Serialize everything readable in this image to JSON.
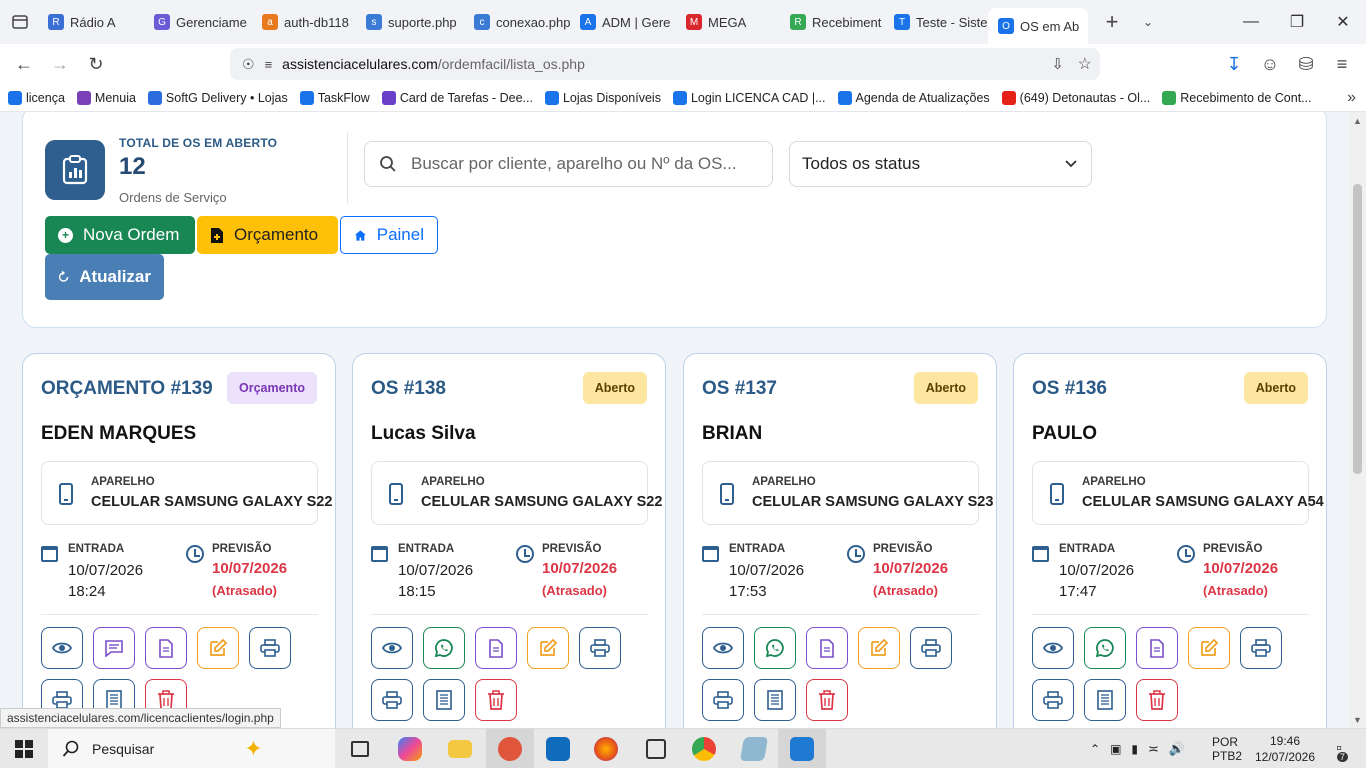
{
  "browser": {
    "tabs": [
      {
        "title": "Rádio A",
        "color": "#3b6fd6",
        "glyph": "R"
      },
      {
        "title": "Gerenciame",
        "color": "#6a5bd6",
        "glyph": "G"
      },
      {
        "title": "auth-db118",
        "color": "#e87a1d",
        "glyph": "a"
      },
      {
        "title": "suporte.php",
        "color": "#3a7bd5",
        "glyph": "s"
      },
      {
        "title": "conexao.php",
        "color": "#3a7bd5",
        "glyph": "c"
      },
      {
        "title": "ADM | Gere",
        "color": "#1a73e8",
        "glyph": "A"
      },
      {
        "title": "MEGA",
        "color": "#d9272e",
        "glyph": "M"
      },
      {
        "title": "Recebiment",
        "color": "#34a853",
        "glyph": "R"
      },
      {
        "title": "Teste - Siste",
        "color": "#1a73e8",
        "glyph": "T"
      },
      {
        "title": "OS em Ab",
        "color": "#1a73e8",
        "glyph": "O",
        "active": true
      }
    ],
    "new_tab": "+",
    "url_host": "assistenciacelulares.com",
    "url_path": "/ordemfacil/lista_os.php",
    "bookmarks": [
      {
        "label": "licença",
        "color": "#1a73e8"
      },
      {
        "label": "Menuia",
        "color": "#7b3fb8"
      },
      {
        "label": "SoftG Delivery • Lojas",
        "color": "#2d6cdf"
      },
      {
        "label": "TaskFlow",
        "color": "#1a73e8"
      },
      {
        "label": "Card de Tarefas - Dee...",
        "color": "#6a3fc9"
      },
      {
        "label": "Lojas Disponíveis",
        "color": "#1a73e8"
      },
      {
        "label": "Login LICENCA CAD  |...",
        "color": "#1a73e8"
      },
      {
        "label": "Agenda de Atualizações",
        "color": "#1a73e8"
      },
      {
        "label": "(649) Detonautas - Ol...",
        "color": "#e62117"
      },
      {
        "label": "Recebimento de Cont...",
        "color": "#34a853"
      }
    ],
    "status_url": "assistenciacelulares.com/licencaclientes/login.php"
  },
  "summary": {
    "label": "TOTAL DE OS EM ABERTO",
    "count": "12",
    "sub": "Ordens de Serviço",
    "search_placeholder": "Buscar por cliente, aparelho ou Nº da OS...",
    "status_select": "Todos os status"
  },
  "buttons": {
    "nova": "Nova Ordem",
    "orcamento": "Orçamento",
    "painel": "Painel",
    "atualizar": "Atualizar"
  },
  "labels": {
    "aparelho": "APARELHO",
    "entrada": "ENTRADA",
    "previsao": "PREVISÃO"
  },
  "cards": [
    {
      "title": "ORÇAMENTO #139",
      "badge": "Orçamento",
      "badge_type": "orc",
      "client": "EDEN MARQUES",
      "device": "CELULAR SAMSUNG GALAXY S22",
      "entrada": "10/07/2026 18:24",
      "previsao": "10/07/2026",
      "previsao_status": "(Atrasado)",
      "second_icon": "message-icon"
    },
    {
      "title": "OS #138",
      "badge": "Aberto",
      "badge_type": "aberto",
      "client": "Lucas Silva",
      "device": "CELULAR SAMSUNG GALAXY S22",
      "entrada": "10/07/2026 18:15",
      "previsao": "10/07/2026",
      "previsao_status": "(Atrasado)",
      "second_icon": "whatsapp-icon"
    },
    {
      "title": "OS #137",
      "badge": "Aberto",
      "badge_type": "aberto",
      "client": "BRIAN",
      "device": "CELULAR SAMSUNG GALAXY S23",
      "entrada": "10/07/2026 17:53",
      "previsao": "10/07/2026",
      "previsao_status": "(Atrasado)",
      "second_icon": "whatsapp-icon"
    },
    {
      "title": "OS #136",
      "badge": "Aberto",
      "badge_type": "aberto",
      "client": "PAULO",
      "device": "CELULAR SAMSUNG GALAXY A54",
      "entrada": "10/07/2026 17:47",
      "previsao": "10/07/2026",
      "previsao_status": "(Atrasado)",
      "second_icon": "whatsapp-icon"
    }
  ],
  "taskbar": {
    "search": "Pesquisar",
    "lang_top": "POR",
    "lang_bottom": "PTB2",
    "time": "19:46",
    "date": "12/07/2026",
    "notif_count": "7"
  }
}
